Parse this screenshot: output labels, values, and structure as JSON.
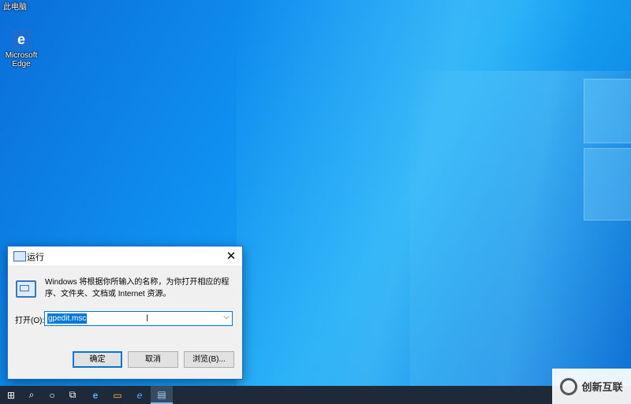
{
  "desktop": {
    "top_label": "此电脑",
    "edge_icon_label": "Microsoft Edge",
    "edge_icon_glyph": "e"
  },
  "run_dialog": {
    "title": "运行",
    "close_glyph": "✕",
    "description": "Windows 将根据你所输入的名称，为你打开相应的程序、文件夹、文档或 Internet 资源。",
    "open_label": "打开(O):",
    "input_value": "gpedit.msc",
    "ok_label": "确定",
    "cancel_label": "取消",
    "browse_label": "浏览(B)..."
  },
  "taskbar": {
    "start_glyph": "⊞",
    "search_glyph": "⌕",
    "cortana_glyph": "○",
    "taskview_glyph": "⧉",
    "edge_glyph": "e",
    "explorer_glyph": "▭",
    "ie_glyph": "e",
    "run_glyph": "▤"
  },
  "watermark": {
    "text": "创新互联"
  },
  "colors": {
    "accent": "#0078d7",
    "taskbar": "#1e2a3a"
  }
}
